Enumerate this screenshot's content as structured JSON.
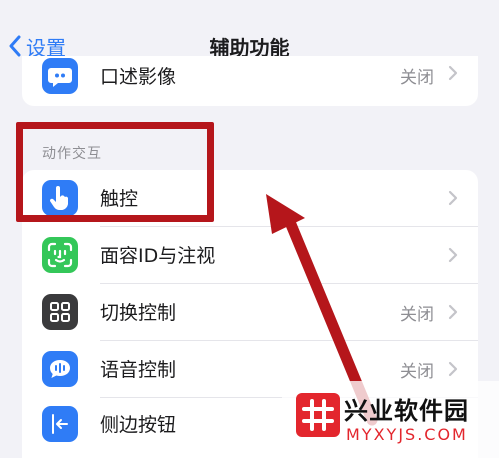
{
  "nav": {
    "back_label": "设置",
    "title": "辅助功能"
  },
  "top_group": {
    "item": {
      "label": "口述影像",
      "value": "关闭",
      "icon": "audio-description-icon",
      "icon_bg": "#2f7cf6"
    }
  },
  "section": {
    "header": "动作交互",
    "items": [
      {
        "label": "触控",
        "value": "",
        "icon": "touch-hand-icon",
        "icon_bg": "#2f7cf6"
      },
      {
        "label": "面容ID与注视",
        "value": "",
        "icon": "face-id-icon",
        "icon_bg": "#34c759"
      },
      {
        "label": "切换控制",
        "value": "关闭",
        "icon": "switch-control-icon",
        "icon_bg": "#3a3a3c"
      },
      {
        "label": "语音控制",
        "value": "关闭",
        "icon": "voice-control-icon",
        "icon_bg": "#2f7cf6"
      },
      {
        "label": "侧边按钮",
        "value": "",
        "icon": "side-button-icon",
        "icon_bg": "#2f7cf6"
      }
    ]
  },
  "colors": {
    "accent": "#2f7cf6",
    "highlight": "#b5161b",
    "background": "#f2f2f7"
  },
  "watermark": {
    "name": "兴业软件园",
    "url": "MYXYJS.COM"
  }
}
